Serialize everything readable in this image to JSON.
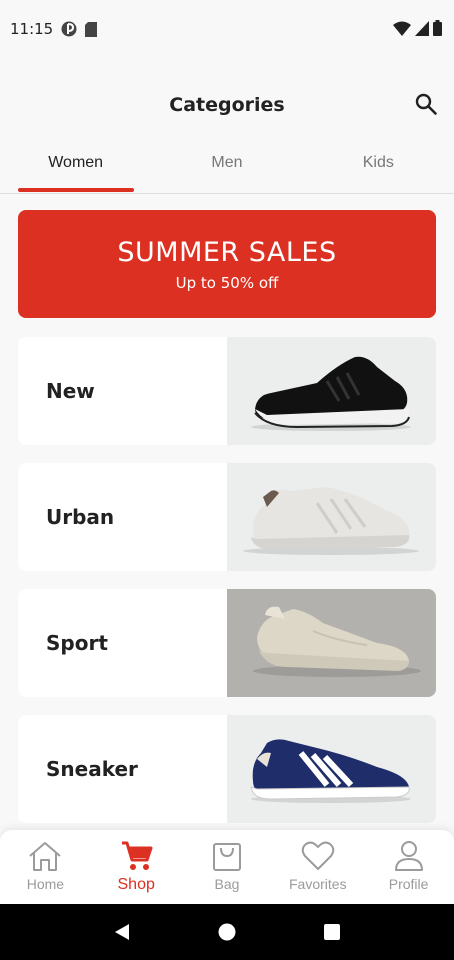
{
  "status_bar": {
    "time": "11:15"
  },
  "header": {
    "title": "Categories"
  },
  "tabs": [
    {
      "label": "Women",
      "active": true
    },
    {
      "label": "Men",
      "active": false
    },
    {
      "label": "Kids",
      "active": false
    }
  ],
  "banner": {
    "title": "SUMMER SALES",
    "subtitle": "Up to 50% off"
  },
  "categories": [
    {
      "label": "New",
      "image": "black-running-shoe"
    },
    {
      "label": "Urban",
      "image": "white-leather-sneaker"
    },
    {
      "label": "Sport",
      "image": "beige-suede-sneaker"
    },
    {
      "label": "Sneaker",
      "image": "navy-gazelle-sneaker"
    }
  ],
  "bottom_nav": [
    {
      "label": "Home",
      "icon": "home-icon",
      "active": false
    },
    {
      "label": "Shop",
      "icon": "cart-icon",
      "active": true
    },
    {
      "label": "Bag",
      "icon": "bag-icon",
      "active": false
    },
    {
      "label": "Favorites",
      "icon": "heart-icon",
      "active": false
    },
    {
      "label": "Profile",
      "icon": "profile-icon",
      "active": false
    }
  ],
  "colors": {
    "accent": "#db3022",
    "background": "#f8f8f8",
    "inactive": "#9b9b9b"
  }
}
